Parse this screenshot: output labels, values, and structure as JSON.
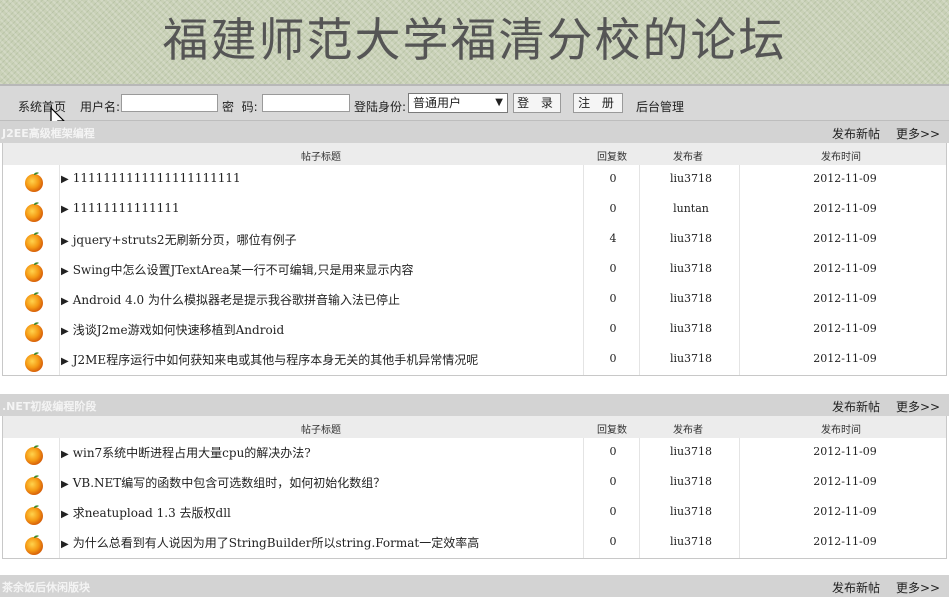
{
  "banner": {
    "title": "福建师范大学福清分校的论坛"
  },
  "login": {
    "home_link": "系统首页",
    "username_label": "用户名:",
    "password_label": "密  码:",
    "role_label": "登陆身份:",
    "role_selected": "普通用户",
    "login_button": "登 录",
    "register_button": "注 册",
    "admin_link": "后台管理"
  },
  "columns": {
    "title": "帖子标题",
    "replies": "回复数",
    "author": "发布者",
    "time": "发布时间"
  },
  "sections": [
    {
      "name": "J2EE高级框架编程",
      "new_post": "发布新帖",
      "more": "更多>>",
      "posts": [
        {
          "title": "1111111111111111111111",
          "replies": "0",
          "author": "liu3718",
          "time": "2012-11-09"
        },
        {
          "title": "11111111111111",
          "replies": "0",
          "author": "luntan",
          "time": "2012-11-09"
        },
        {
          "title": "jquery+struts2无刷新分页，哪位有例子",
          "replies": "4",
          "author": "liu3718",
          "time": "2012-11-09"
        },
        {
          "title": "Swing中怎么设置JTextArea某一行不可编辑,只是用来显示内容",
          "replies": "0",
          "author": "liu3718",
          "time": "2012-11-09"
        },
        {
          "title": "Android 4.0 为什么模拟器老是提示我谷歌拼音输入法已停止",
          "replies": "0",
          "author": "liu3718",
          "time": "2012-11-09"
        },
        {
          "title": "浅谈J2me游戏如何快速移植到Android",
          "replies": "0",
          "author": "liu3718",
          "time": "2012-11-09"
        },
        {
          "title": "J2ME程序运行中如何获知来电或其他与程序本身无关的其他手机异常情况呢",
          "replies": "0",
          "author": "liu3718",
          "time": "2012-11-09"
        }
      ]
    },
    {
      "name": ".NET初级编程阶段",
      "new_post": "发布新帖",
      "more": "更多>>",
      "posts": [
        {
          "title": "win7系统中断进程占用大量cpu的解决办法?",
          "replies": "0",
          "author": "liu3718",
          "time": "2012-11-09"
        },
        {
          "title": "VB.NET编写的函数中包含可选数组时，如何初始化数组？",
          "replies": "0",
          "author": "liu3718",
          "time": "2012-11-09"
        },
        {
          "title": "求neatupload 1.3 去版权dll",
          "replies": "0",
          "author": "liu3718",
          "time": "2012-11-09"
        },
        {
          "title": "为什么总看到有人说因为用了StringBuilder所以string.Format一定效率高",
          "replies": "0",
          "author": "liu3718",
          "time": "2012-11-09"
        }
      ]
    },
    {
      "name": "茶余饭后休闲版块",
      "new_post": "发布新帖",
      "more": "更多>>",
      "posts": []
    }
  ]
}
